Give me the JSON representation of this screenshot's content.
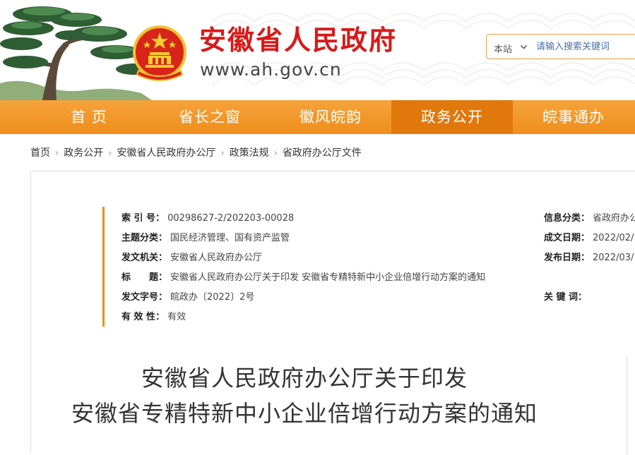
{
  "header": {
    "site_title": "安徽省人民政府",
    "site_url": "www.ah.gov.cn",
    "search": {
      "scope": "本站",
      "placeholder": "请输入搜索关键词"
    }
  },
  "nav": {
    "items": [
      "首 页",
      "省长之窗",
      "徽风皖韵",
      "政务公开",
      "皖事通办"
    ],
    "active": "政务公开"
  },
  "breadcrumb": [
    "首页",
    "政务公开",
    "安徽省人民政府办公厅",
    "政策法规",
    "省政府办公厅文件"
  ],
  "info": {
    "index_label": "索 引 号：",
    "index_value": "00298627-2/202203-00028",
    "topic_label": "主题分类：",
    "topic_value": "国民经济管理、国有资产监管",
    "issuer_label": "发文机关：",
    "issuer_value": "安徽省人民政府办公厅",
    "title_label": "标　　题：",
    "title_value": "安徽省人民政府办公厅关于印发 安徽省专精特新中小企业倍增行动方案的通知",
    "docno_label": "发文字号：",
    "docno_value": "皖政办〔2022〕2号",
    "validity_label": "有 效 性：",
    "validity_value": "有效",
    "category_label": "信息分类：",
    "category_value": "省政府办公",
    "written_label": "成文日期：",
    "written_value": "2022/02/",
    "published_label": "发布日期：",
    "published_value": "2022/03/",
    "keywords_label": "关 键 词：",
    "keywords_value": ""
  },
  "document": {
    "title_line1": "安徽省人民政府办公厅关于印发",
    "title_line2": "安徽省专精特新中小企业倍增行动方案的通知"
  },
  "colors": {
    "brand_red": "#d71a18",
    "nav_orange": "#ef8e1c",
    "nav_active": "#e0780b",
    "accent_bar": "#f08c1a"
  }
}
